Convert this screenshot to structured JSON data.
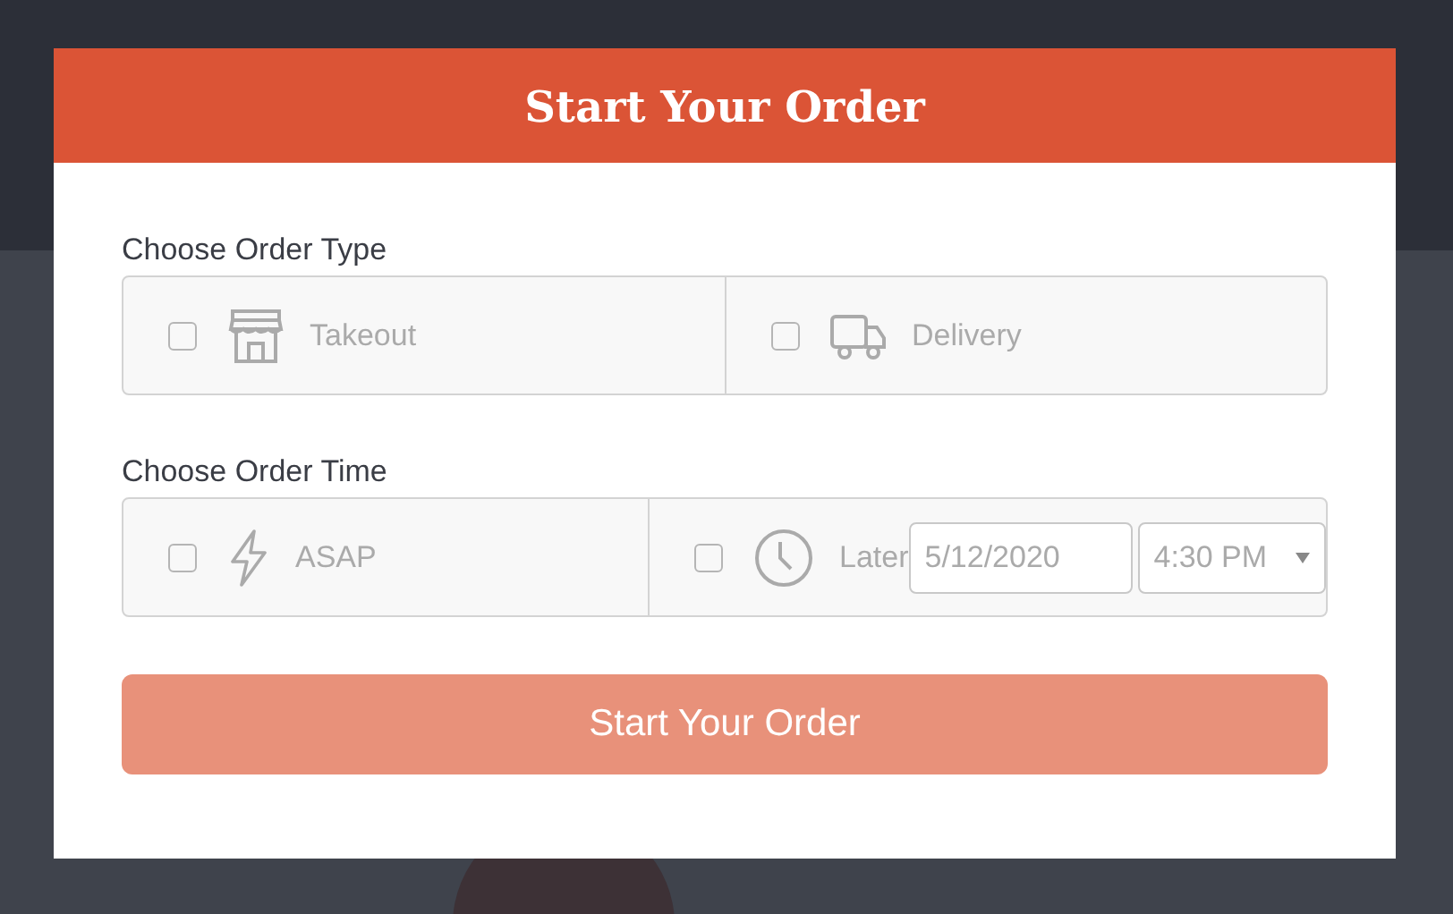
{
  "dialog": {
    "title": "Start Your Order"
  },
  "order_type": {
    "label": "Choose Order Type",
    "options": [
      {
        "kind": "store",
        "label": "Takeout",
        "checked": false
      },
      {
        "kind": "truck",
        "label": "Delivery",
        "checked": false
      }
    ]
  },
  "order_time": {
    "label": "Choose Order Time",
    "options": [
      {
        "kind": "bolt",
        "label": "ASAP",
        "checked": false
      },
      {
        "kind": "clock",
        "label": "Later",
        "checked": false,
        "date": "5/12/2020",
        "time": "4:30 PM"
      }
    ]
  },
  "submit": {
    "label": "Start Your Order",
    "disabled": true
  }
}
